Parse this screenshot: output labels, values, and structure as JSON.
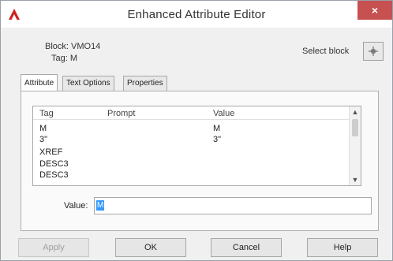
{
  "window": {
    "title": "Enhanced Attribute Editor",
    "close_glyph": "×"
  },
  "info": {
    "block_label": "Block: VMO14",
    "tag_label": "Tag: M"
  },
  "select_block": {
    "label": "Select block",
    "icon": "crosshair-pick-icon"
  },
  "tabs": [
    {
      "label": "Attribute",
      "active": true
    },
    {
      "label": "Text Options",
      "active": false
    },
    {
      "label": "Properties",
      "active": false
    }
  ],
  "list": {
    "columns": [
      "Tag",
      "Prompt",
      "Value"
    ],
    "rows": [
      {
        "tag": "M",
        "prompt": "",
        "value": "M"
      },
      {
        "tag": "3\"",
        "prompt": "",
        "value": "3\""
      },
      {
        "tag": "XREF",
        "prompt": "",
        "value": ""
      },
      {
        "tag": "DESC3",
        "prompt": "",
        "value": ""
      },
      {
        "tag": "DESC3",
        "prompt": "",
        "value": ""
      }
    ]
  },
  "value_field": {
    "label": "Value:",
    "value": "M"
  },
  "buttons": {
    "apply": "Apply",
    "ok": "OK",
    "cancel": "Cancel",
    "help": "Help"
  },
  "colors": {
    "close_bg": "#c75050",
    "app_icon": "#d21f1f",
    "selection": "#3399ff"
  }
}
